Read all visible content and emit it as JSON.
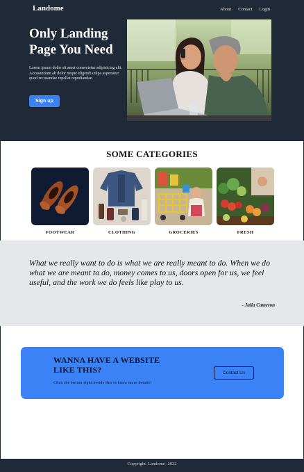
{
  "header": {
    "brand": "Landome",
    "nav": [
      "About",
      "Contact",
      "Login"
    ]
  },
  "hero": {
    "title": "Only Landing Page You Need",
    "text": "Lorem ipsum dolor sit amet consectetur adipisicing elit. Accusantium ab dolor neque eligendi culpa asperiatur quod recusandae repellat repudiandae.",
    "signup_label": "Sign up"
  },
  "categories": {
    "title": "SOME CATEGORIES",
    "items": [
      {
        "label": "FOOTWEAR",
        "image": "shoes-photo"
      },
      {
        "label": "CLOTHING",
        "image": "clothing-flatlay-photo"
      },
      {
        "label": "GROCERIES",
        "image": "shopping-cart-child-photo"
      },
      {
        "label": "FRESH",
        "image": "fresh-produce-photo"
      }
    ]
  },
  "quote": {
    "text": "What we really want to do is what we are really meant to do. When we do what we are meant to do, money comes to us, doors open for us, we feel useful, and the work we do feels like play to us.",
    "author": "- Julia Cameron"
  },
  "cta": {
    "title": "WANNA HAVE A WEBSITE LIKE THIS?",
    "subtitle": "Click the button right beside this to know more details!",
    "button_label": "Contact Us"
  },
  "footer": {
    "text": "Copyright. Landome -2022"
  },
  "colors": {
    "dark": "#1f2937",
    "accent": "#3b82f6",
    "quote_band": "#e5e7eb"
  }
}
